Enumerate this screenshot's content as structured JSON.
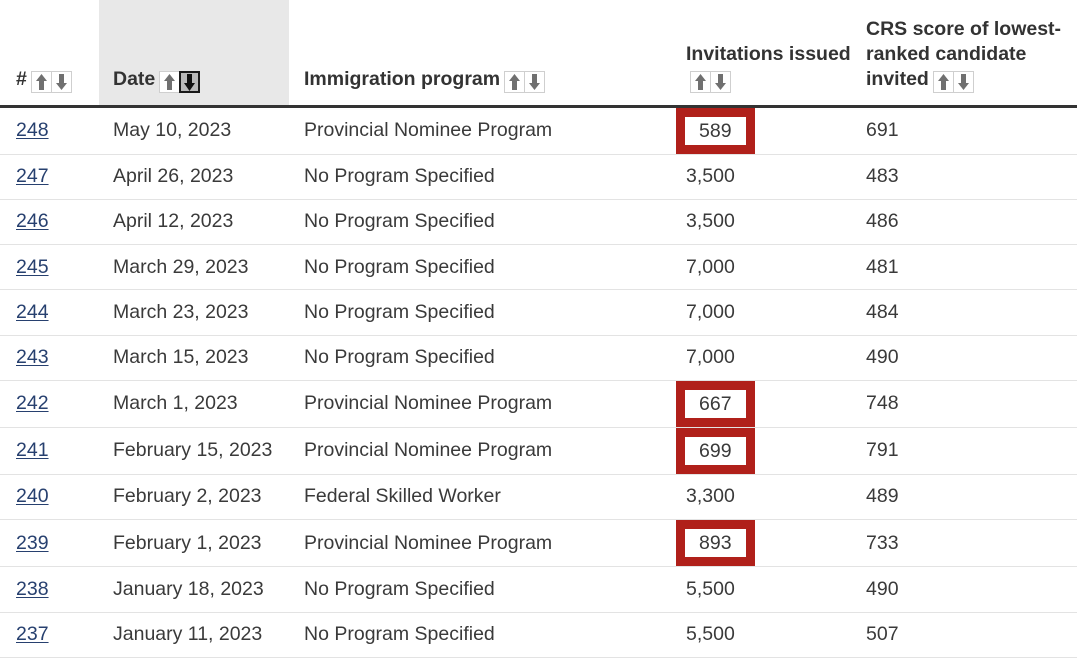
{
  "table": {
    "columns": [
      {
        "key": "num",
        "label": "#",
        "sortable": true,
        "active_sort": null
      },
      {
        "key": "date",
        "label": "Date",
        "sortable": true,
        "active_sort": "desc"
      },
      {
        "key": "prog",
        "label": "Immigration program",
        "sortable": true,
        "active_sort": null
      },
      {
        "key": "inv",
        "label": "Invitations issued",
        "sortable": true,
        "active_sort": null
      },
      {
        "key": "crs",
        "label": "CRS score of lowest-ranked candidate invited",
        "sortable": true,
        "active_sort": null
      }
    ],
    "sort_icons": {
      "asc": "arrow-up-icon",
      "desc": "arrow-down-icon"
    },
    "highlight_color": "#b0201a",
    "link_color": "#27406f",
    "rows": [
      {
        "num": "248",
        "date": "May 10, 2023",
        "prog": "Provincial Nominee Program",
        "inv": "589",
        "crs": "691",
        "inv_highlighted": true
      },
      {
        "num": "247",
        "date": "April 26, 2023",
        "prog": "No Program Specified",
        "inv": "3,500",
        "crs": "483",
        "inv_highlighted": false
      },
      {
        "num": "246",
        "date": "April 12, 2023",
        "prog": "No Program Specified",
        "inv": "3,500",
        "crs": "486",
        "inv_highlighted": false
      },
      {
        "num": "245",
        "date": "March 29, 2023",
        "prog": "No Program Specified",
        "inv": "7,000",
        "crs": "481",
        "inv_highlighted": false
      },
      {
        "num": "244",
        "date": "March 23, 2023",
        "prog": "No Program Specified",
        "inv": "7,000",
        "crs": "484",
        "inv_highlighted": false
      },
      {
        "num": "243",
        "date": "March 15, 2023",
        "prog": "No Program Specified",
        "inv": "7,000",
        "crs": "490",
        "inv_highlighted": false
      },
      {
        "num": "242",
        "date": "March 1, 2023",
        "prog": "Provincial Nominee Program",
        "inv": "667",
        "crs": "748",
        "inv_highlighted": true
      },
      {
        "num": "241",
        "date": "February 15, 2023",
        "prog": "Provincial Nominee Program",
        "inv": "699",
        "crs": "791",
        "inv_highlighted": true
      },
      {
        "num": "240",
        "date": "February 2, 2023",
        "prog": "Federal Skilled Worker",
        "inv": "3,300",
        "crs": "489",
        "inv_highlighted": false
      },
      {
        "num": "239",
        "date": "February 1, 2023",
        "prog": "Provincial Nominee Program",
        "inv": "893",
        "crs": "733",
        "inv_highlighted": true
      },
      {
        "num": "238",
        "date": "January 18, 2023",
        "prog": "No Program Specified",
        "inv": "5,500",
        "crs": "490",
        "inv_highlighted": false
      },
      {
        "num": "237",
        "date": "January 11, 2023",
        "prog": "No Program Specified",
        "inv": "5,500",
        "crs": "507",
        "inv_highlighted": false
      }
    ]
  }
}
